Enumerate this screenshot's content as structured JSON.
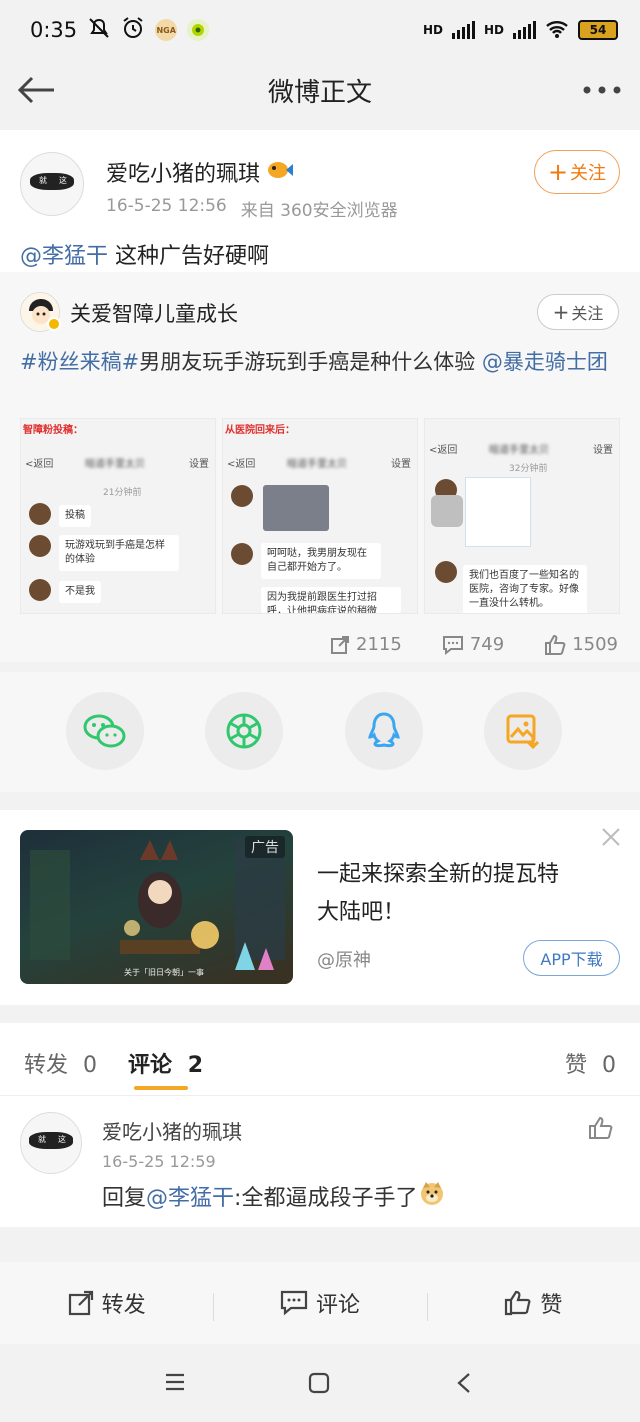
{
  "status_bar": {
    "time": "0:35",
    "nga": "NGA",
    "hd1": "HD",
    "hd2": "HD",
    "battery": "54"
  },
  "header": {
    "title": "微博正文"
  },
  "post": {
    "author": "爱吃小猪的珮琪",
    "avatar_text_left": "就",
    "avatar_text_right": "这",
    "time": "16-5-25 12:56",
    "source": "来自 360安全浏览器",
    "follow": "关注",
    "mention": "@李猛干",
    "text": " 这种广告好硬啊"
  },
  "retweet": {
    "author": "关爱智障儿童成长",
    "follow": "关注",
    "tag1": "#粉丝来稿#",
    "body": "男朋友玩手游玩到手癌是种什么体验 ",
    "mention": "@暴走骑士团",
    "images": [
      {
        "caption": "智障粉投稿：",
        "nav_title": "暗道手里太贝",
        "nav_left": "<返回",
        "nav_right": "设置",
        "stamp": "21分钟前",
        "bubbles": [
          "投稿",
          "玩游戏玩到手癌是怎样的体验",
          "不是我"
        ]
      },
      {
        "caption": "从医院回来后：",
        "nav_title": "暗道手里太贝",
        "nav_left": "<返回",
        "nav_right": "设置",
        "bubbles": [
          "呵呵哒，我男朋友现在自己都开始方了。",
          "因为我提前跟医生打过招呼，让他把病症说的稍微"
        ]
      },
      {
        "caption": "",
        "nav_title": "暗道手里太贝",
        "nav_left": "<返回",
        "nav_right": "设置",
        "stamp": "32分钟前",
        "bubbles": [
          "我们也百度了一些知名的医院，咨询了专家。好像一直没什么转机。"
        ]
      }
    ],
    "reposts": "2115",
    "comments": "749",
    "likes": "1509"
  },
  "ad": {
    "label": "广告",
    "line1": "一起来探索全新的提瓦特",
    "line2": "大陆吧！",
    "brand": "@原神",
    "button": "APP下载",
    "caption": "关于「旧日今朝」一事"
  },
  "tabs": {
    "repost_label": "转发",
    "repost_count": "0",
    "comment_label": "评论",
    "comment_count": "2",
    "like_label": "赞",
    "like_count": "0"
  },
  "comment": {
    "author": "爱吃小猪的珮琪",
    "time": "16-5-25 12:59",
    "prefix": "回复",
    "mention": "@李猛干",
    "text": ":全都逼成段子手了"
  },
  "bottom": {
    "repost": "转发",
    "comment": "评论",
    "like": "赞"
  },
  "colors": {
    "accent_orange": "#f07a10",
    "link_blue": "#436ea5",
    "wechat_green": "#30c76d",
    "qq_blue": "#3ba6f0"
  }
}
